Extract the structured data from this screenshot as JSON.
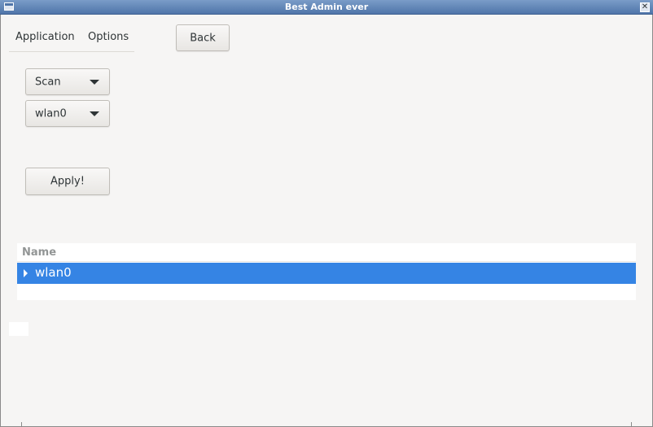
{
  "window": {
    "title": "Best Admin ever",
    "close_glyph": "✕"
  },
  "menubar": {
    "items": [
      {
        "label": "Application"
      },
      {
        "label": "Options"
      }
    ]
  },
  "toolbar": {
    "back_label": "Back"
  },
  "controls": {
    "mode_combo": {
      "selected": "Scan"
    },
    "interface_combo": {
      "selected": "wlan0"
    },
    "apply_label": "Apply!"
  },
  "tree": {
    "columns": [
      {
        "label": "Name"
      }
    ],
    "rows": [
      {
        "label": "wlan0",
        "selected": true,
        "expandable": true
      }
    ]
  },
  "colors": {
    "selection": "#3584e4",
    "window_bg": "#f6f5f4",
    "titlebar": "#4f75a9"
  },
  "icons": [
    "window-menu-icon",
    "close-icon",
    "chevron-down-icon",
    "expander-right-icon"
  ]
}
